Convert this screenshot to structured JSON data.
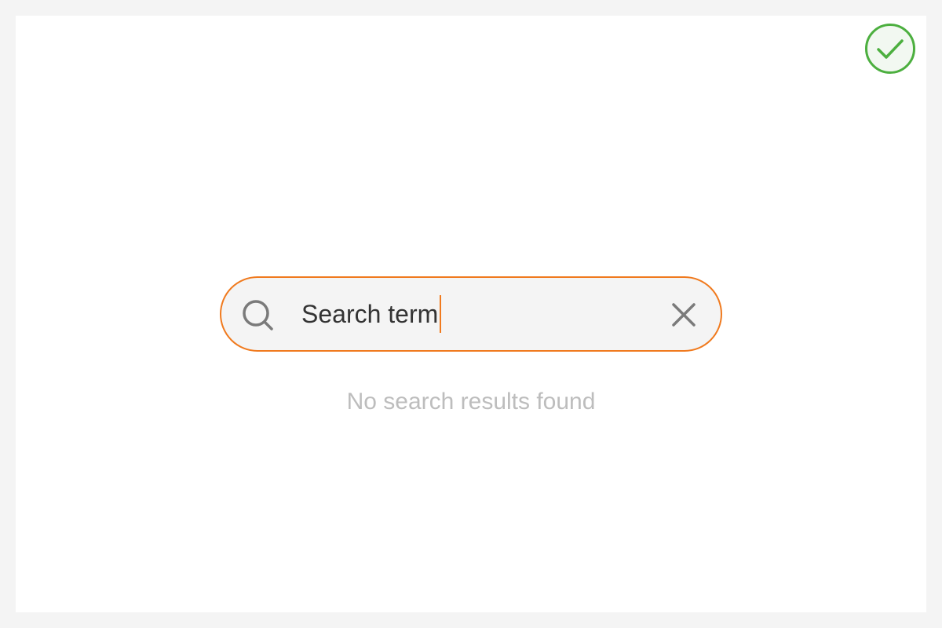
{
  "status": {
    "icon": "check-circle-icon",
    "color": "#4caf3f"
  },
  "search": {
    "value": "Search term",
    "search_icon": "search-icon",
    "clear_icon": "close-icon",
    "accent_color": "#f07a1e"
  },
  "results": {
    "empty_message": "No search results found"
  }
}
